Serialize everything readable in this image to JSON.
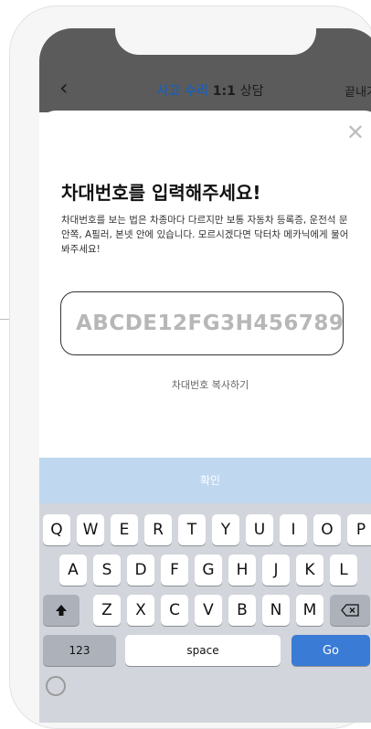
{
  "header": {
    "back_icon": "chevron-left-icon",
    "title_accent": "사고 수리",
    "title_main": "1:1",
    "title_suffix": "상담",
    "end_label": "끝내기"
  },
  "sheet": {
    "close_icon": "close-icon",
    "heading": "차대번호를 입력해주세요!",
    "description": "차대번호를 보는 법은 차종마다 다르지만 보통 자동차 등록증, 운전석 문 안쪽, A필러, 본넷 안에 있습니다. 모르시겠다면 닥터차 메카닉에게 물어봐주세요!",
    "vin_placeholder": "ABCDE12FG3H456789",
    "copy_link": "차대번호 복사하기",
    "confirm_label": "확인"
  },
  "keyboard": {
    "row1": [
      "Q",
      "W",
      "E",
      "R",
      "T",
      "Y",
      "U",
      "I",
      "O",
      "P"
    ],
    "row2": [
      "A",
      "S",
      "D",
      "F",
      "G",
      "H",
      "J",
      "K",
      "L"
    ],
    "row3": [
      "Z",
      "X",
      "C",
      "V",
      "B",
      "N",
      "M"
    ],
    "shift_icon": "shift-icon",
    "delete_icon": "backspace-icon",
    "numbers_label": "123",
    "space_label": "space",
    "go_label": "Go"
  },
  "colors": {
    "header_bg": "#5b5b5b",
    "accent": "#1f5fb0",
    "confirm_bg": "#bfd8f0",
    "go_key": "#3a7bd5",
    "keyboard_bg": "#d2d5db"
  }
}
